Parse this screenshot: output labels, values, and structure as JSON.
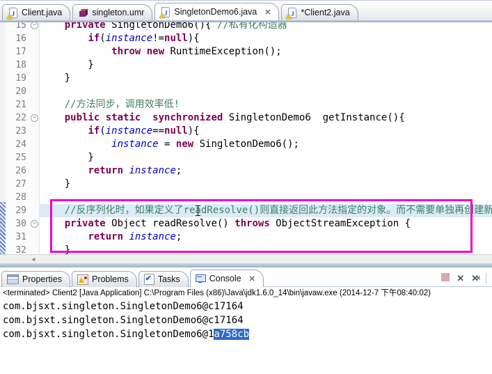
{
  "glyphs": {
    "close": "✕",
    "minus": "−",
    "left_arrow": "◄",
    "java": "J",
    "check": "✔"
  },
  "colors": {
    "keyword": "#7f0055",
    "comment": "#3f7f5f",
    "static_field": "#0000c0",
    "current_line": "#dcebf7",
    "annotation_box": "#f000c8",
    "selection": "#316ac5"
  },
  "editor_tabs": [
    {
      "label": "Client.java",
      "active": false
    },
    {
      "label": "singleton.umr",
      "active": false
    },
    {
      "label": "SingletonDemo6.java",
      "active": true
    },
    {
      "label": "*Client2.java",
      "active": false
    }
  ],
  "code": {
    "lines": [
      {
        "n": "15",
        "fold": true,
        "current": false,
        "seg": [
          [
            "pl",
            "    "
          ],
          [
            "kw",
            "private"
          ],
          [
            "pl",
            " SingletonDemo6(){ "
          ],
          [
            "cm",
            "//私有化构造器"
          ]
        ]
      },
      {
        "n": "16",
        "fold": false,
        "current": false,
        "seg": [
          [
            "pl",
            "        "
          ],
          [
            "kw",
            "if"
          ],
          [
            "pl",
            "("
          ],
          [
            "fld",
            "instance"
          ],
          [
            "pl",
            "!="
          ],
          [
            "kw",
            "null"
          ],
          [
            "pl",
            "){"
          ]
        ]
      },
      {
        "n": "17",
        "fold": false,
        "current": false,
        "seg": [
          [
            "pl",
            "            "
          ],
          [
            "kw",
            "throw"
          ],
          [
            "pl",
            " "
          ],
          [
            "kw",
            "new"
          ],
          [
            "pl",
            " RuntimeException();"
          ]
        ]
      },
      {
        "n": "18",
        "fold": false,
        "current": false,
        "seg": [
          [
            "pl",
            "        }"
          ]
        ]
      },
      {
        "n": "19",
        "fold": false,
        "current": false,
        "seg": [
          [
            "pl",
            "    }"
          ]
        ]
      },
      {
        "n": "20",
        "fold": false,
        "current": false,
        "seg": []
      },
      {
        "n": "21",
        "fold": false,
        "current": false,
        "seg": [
          [
            "pl",
            "    "
          ],
          [
            "cm",
            "//方法同步，调用效率低!"
          ]
        ]
      },
      {
        "n": "22",
        "fold": true,
        "current": false,
        "seg": [
          [
            "pl",
            "    "
          ],
          [
            "kw",
            "public"
          ],
          [
            "pl",
            " "
          ],
          [
            "kw",
            "static"
          ],
          [
            "pl",
            "  "
          ],
          [
            "kw",
            "synchronized"
          ],
          [
            "pl",
            " SingletonDemo6  getInstance(){"
          ]
        ]
      },
      {
        "n": "23",
        "fold": false,
        "current": false,
        "seg": [
          [
            "pl",
            "        "
          ],
          [
            "kw",
            "if"
          ],
          [
            "pl",
            "("
          ],
          [
            "fld",
            "instance"
          ],
          [
            "pl",
            "=="
          ],
          [
            "kw",
            "null"
          ],
          [
            "pl",
            "){"
          ]
        ]
      },
      {
        "n": "24",
        "fold": false,
        "current": false,
        "seg": [
          [
            "pl",
            "            "
          ],
          [
            "fld",
            "instance"
          ],
          [
            "pl",
            " = "
          ],
          [
            "kw",
            "new"
          ],
          [
            "pl",
            " SingletonDemo6();"
          ]
        ]
      },
      {
        "n": "25",
        "fold": false,
        "current": false,
        "seg": [
          [
            "pl",
            "        }"
          ]
        ]
      },
      {
        "n": "26",
        "fold": false,
        "current": false,
        "seg": [
          [
            "pl",
            "        "
          ],
          [
            "kw",
            "return"
          ],
          [
            "pl",
            " "
          ],
          [
            "fld",
            "instance"
          ],
          [
            "pl",
            ";"
          ]
        ]
      },
      {
        "n": "27",
        "fold": false,
        "current": false,
        "seg": [
          [
            "pl",
            "    }"
          ]
        ]
      },
      {
        "n": "28",
        "fold": false,
        "current": false,
        "seg": []
      },
      {
        "n": "29",
        "fold": false,
        "current": true,
        "seg": [
          [
            "pl",
            "    "
          ],
          [
            "cm",
            "//反序列化时，如果定义了readResolve()则直接返回此方法指定的对象。而不需要单独再创建新对象!"
          ]
        ]
      },
      {
        "n": "30",
        "fold": true,
        "current": false,
        "seg": [
          [
            "pl",
            "    "
          ],
          [
            "kw",
            "private"
          ],
          [
            "pl",
            " Object readResolve() "
          ],
          [
            "kw",
            "throws"
          ],
          [
            "pl",
            " ObjectStreamException {"
          ]
        ]
      },
      {
        "n": "31",
        "fold": false,
        "current": false,
        "seg": [
          [
            "pl",
            "        "
          ],
          [
            "kw",
            "return"
          ],
          [
            "pl",
            " "
          ],
          [
            "fld",
            "instance"
          ],
          [
            "pl",
            ";"
          ]
        ]
      },
      {
        "n": "32",
        "fold": false,
        "current": false,
        "seg": [
          [
            "pl",
            "    }"
          ]
        ]
      }
    ]
  },
  "view_tabs": [
    {
      "label": "Properties",
      "active": false
    },
    {
      "label": "Problems",
      "active": false
    },
    {
      "label": "Tasks",
      "active": false
    },
    {
      "label": "Console",
      "active": true
    }
  ],
  "console": {
    "status": "<terminated> Client2 [Java Application] C:\\Program Files (x86)\\Java\\jdk1.6.0_14\\bin\\javaw.exe (2014-12-7 下午08:40:02)",
    "lines": [
      {
        "text": "com.bjsxt.singleton.SingletonDemo6@c17164",
        "selected": ""
      },
      {
        "text": "com.bjsxt.singleton.SingletonDemo6@c17164",
        "selected": ""
      },
      {
        "text": "com.bjsxt.singleton.SingletonDemo6@1",
        "selected": "a758cb"
      }
    ]
  }
}
